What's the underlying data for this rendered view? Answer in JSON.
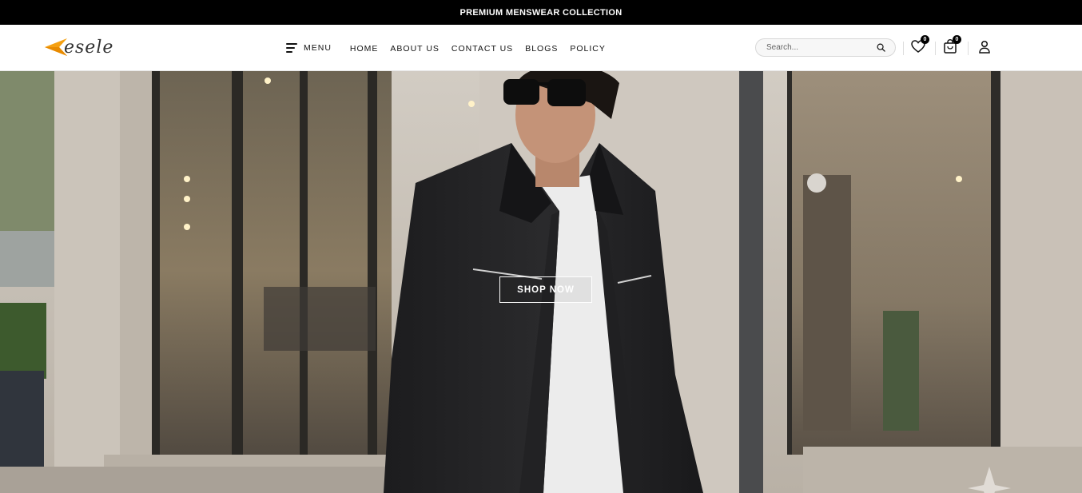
{
  "announcement": {
    "text": "PREMIUM MENSWEAR COLLECTION"
  },
  "header": {
    "logo_text": "esele",
    "menu_label": "MENU",
    "nav": [
      {
        "label": "HOME"
      },
      {
        "label": "ABOUT US"
      },
      {
        "label": "CONTACT US"
      },
      {
        "label": "BLOGS"
      },
      {
        "label": "POLICY"
      }
    ],
    "search": {
      "placeholder": "Search...",
      "value": ""
    },
    "wishlist_count": "0",
    "cart_count": "0"
  },
  "hero": {
    "cta_label": "SHOP NOW",
    "image_subject": "man-in-black-jacket-storefront"
  },
  "colors": {
    "accent": "#f5a011",
    "announcement_bg": "#000000",
    "text": "#111111"
  }
}
